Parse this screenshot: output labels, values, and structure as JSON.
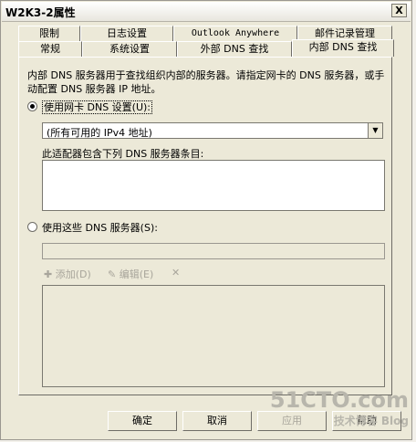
{
  "window": {
    "title": "W2K3-2属性",
    "close": "X"
  },
  "tabs_row1": [
    "限制",
    "日志设置",
    "Outlook Anywhere",
    "邮件记录管理"
  ],
  "tabs_row2": [
    "常规",
    "系统设置",
    "外部 DNS 查找",
    "内部 DNS 查找"
  ],
  "panel": {
    "description": "内部 DNS 服务器用于查找组织内部的服务器。请指定网卡的 DNS 服务器，或手动配置 DNS 服务器 IP 地址。",
    "radio_adapter_label": "使用网卡 DNS 设置(U):",
    "adapter_select_value": "(所有可用的 IPv4 地址)",
    "adapter_list_label": "此适配器包含下列 DNS 服务器条目:",
    "radio_servers_label": "使用这些 DNS 服务器(S):",
    "add_label": "添加(D)",
    "edit_label": "编辑(E)",
    "delete_symbol": "✕"
  },
  "buttons": {
    "ok": "确定",
    "cancel": "取消",
    "apply": "应用",
    "help": "帮助"
  },
  "watermark": {
    "main": "51CTO.com",
    "sub": "技术博客 Blog"
  }
}
